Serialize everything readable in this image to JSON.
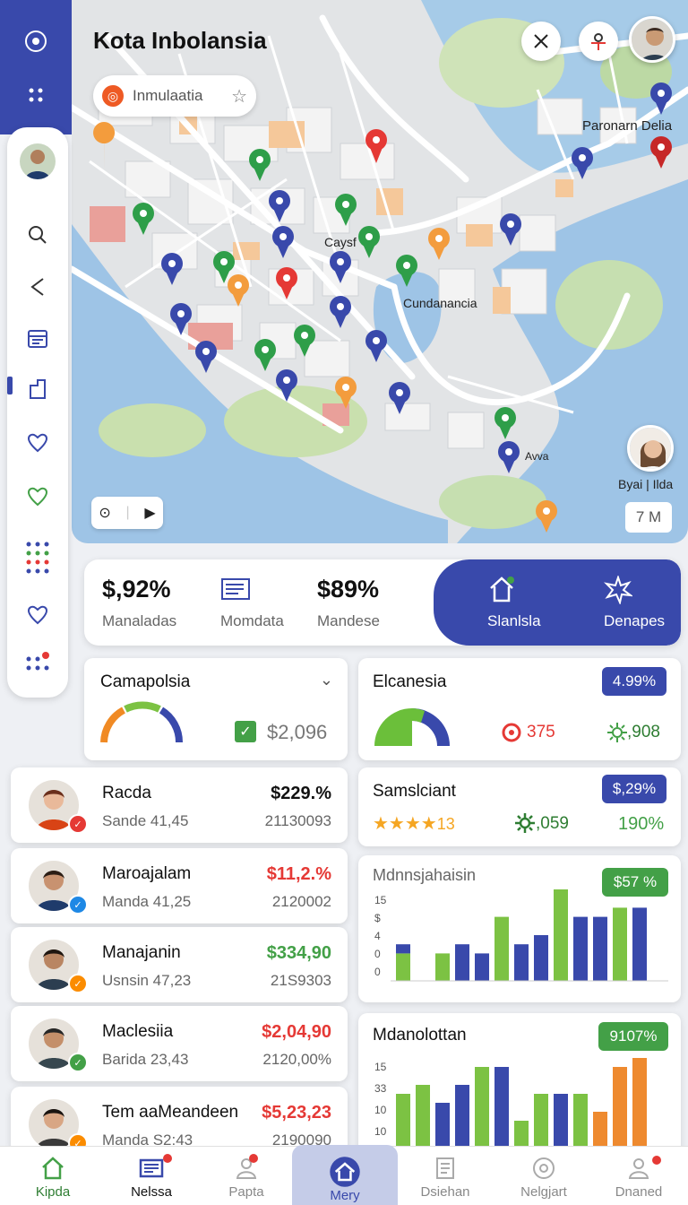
{
  "map": {
    "title": "Kota Inbolansia",
    "search_text": "Inmulaatia",
    "labels": {
      "top_right": "Paronarn Delia",
      "center": "Caysf",
      "lake": "Cundanancia",
      "right_avatar": "Byai | Ilda",
      "small": "Avva"
    },
    "scale_text": "7 M"
  },
  "stats": [
    {
      "value": "$,92%",
      "label": "Manaladas"
    },
    {
      "value": "",
      "label": "Momdata"
    },
    {
      "value": "$89%",
      "label": "Mandese"
    },
    {
      "value": "",
      "label": "Slanlsla"
    },
    {
      "value": "",
      "label": "Denapes"
    }
  ],
  "cards": {
    "gauge_card": {
      "title": "Camapolsia",
      "value": "$2,096"
    },
    "donut_card": {
      "title": "Elcanesia",
      "pill": "4.99%",
      "left_value": "375",
      "right_value": ",908"
    },
    "rating_card": {
      "title": "Samslciant",
      "pill": "$,29%",
      "rating": "13",
      "mid_value": ",059",
      "right_value": "190%"
    },
    "bar_card_1": {
      "title": "Mdnnsjahaisin",
      "pill": "$57 %",
      "ylabels": [
        "15",
        "$",
        "4",
        "0",
        "0"
      ]
    },
    "bar_card_2": {
      "title": "Mdanolottan",
      "pill": "9107%",
      "ylabels": [
        "15",
        "33",
        "10",
        "10"
      ]
    }
  },
  "chart_data": [
    {
      "type": "bar",
      "title": "Mdnnsjahaisin",
      "series": [
        {
          "color": "#7cc243",
          "values": [
            3,
            0,
            3,
            0,
            0,
            7,
            0,
            0,
            10,
            0,
            0,
            8,
            0
          ]
        },
        {
          "color": "#3949ab",
          "values": [
            1,
            0,
            0,
            4,
            3,
            0,
            4,
            5,
            0,
            7,
            7,
            0,
            8
          ]
        }
      ],
      "ylim": [
        0,
        10
      ]
    },
    {
      "type": "bar",
      "title": "Mdanolottan",
      "series": [
        {
          "color": "#7cc243",
          "values": [
            6,
            7,
            0,
            0,
            9,
            0,
            3,
            6,
            0,
            6,
            0,
            0,
            0
          ]
        },
        {
          "color": "#3949ab",
          "values": [
            0,
            0,
            5,
            7,
            0,
            9,
            0,
            0,
            6,
            0,
            0,
            0,
            0
          ]
        },
        {
          "color": "#ee8a2f",
          "values": [
            0,
            0,
            0,
            0,
            0,
            0,
            0,
            0,
            0,
            0,
            4,
            9,
            10
          ]
        }
      ],
      "ylim": [
        0,
        10
      ]
    }
  ],
  "people": [
    {
      "name": "Racda",
      "sub": "Sande 41,45",
      "amount": "$229.%",
      "amount2": "21130093",
      "amount_color": "#111111",
      "badge_color": "#e53935"
    },
    {
      "name": "Maroajalam",
      "sub": "Manda 41,25",
      "amount": "$11,2.%",
      "amount2": "2120002",
      "amount_color": "#e53935",
      "badge_color": "#1e88e5"
    },
    {
      "name": "Manajanin",
      "sub": "Usnsin 47,23",
      "amount": "$334,90",
      "amount2": "21S9303",
      "amount_color": "#43a047",
      "badge_color": "#fb8c00"
    },
    {
      "name": "Maclesiia",
      "sub": "Barida 23,43",
      "amount": "$2,04,90",
      "amount2": "2120,00%",
      "amount_color": "#e53935",
      "badge_color": "#43a047"
    },
    {
      "name": "Tem aaMeandeen",
      "sub": "Manda S2:43",
      "amount": "$5,23,23",
      "amount2": "2190090",
      "amount_color": "#e53935",
      "badge_color": "#fb8c00"
    }
  ],
  "nav": [
    {
      "label": "Kipda",
      "icon": "home-icon"
    },
    {
      "label": "Nelssa",
      "icon": "news-icon"
    },
    {
      "label": "Papta",
      "icon": "user-icon"
    },
    {
      "label": "Mery",
      "icon": "home-icon"
    },
    {
      "label": "Dsiehan",
      "icon": "document-icon"
    },
    {
      "label": "Nelgjart",
      "icon": "at-icon"
    },
    {
      "label": "Dnaned",
      "icon": "person-icon"
    }
  ]
}
